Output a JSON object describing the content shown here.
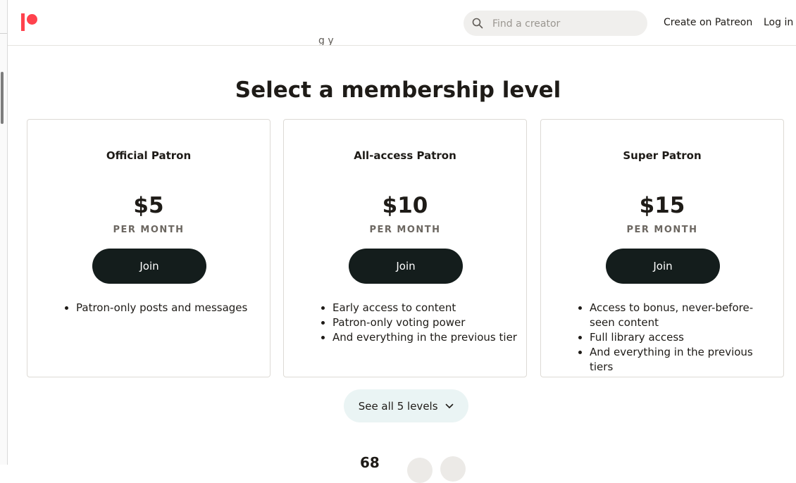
{
  "header": {
    "search_placeholder": "Find a creator",
    "create_label": "Create on Patreon",
    "login_label": "Log in"
  },
  "main": {
    "clipped_text": "g   y",
    "title": "Select a membership level",
    "tiers": [
      {
        "name": "Official Patron",
        "price": "$5",
        "period": "PER MONTH",
        "join_label": "Join",
        "benefits": [
          "Patron-only posts and messages"
        ]
      },
      {
        "name": "All-access Patron",
        "price": "$10",
        "period": "PER MONTH",
        "join_label": "Join",
        "benefits": [
          "Early access to content",
          "Patron-only voting power",
          "And everything in the previous tier"
        ]
      },
      {
        "name": "Super Patron",
        "price": "$15",
        "period": "PER MONTH",
        "join_label": "Join",
        "benefits": [
          "Access to bonus, never-before-seen content",
          "Full library access",
          "And everything in the previous tiers"
        ]
      }
    ],
    "see_all_label": "See all 5 levels",
    "bottom_number": "68"
  },
  "colors": {
    "brand": "#ff424d",
    "join_button": "#141d1c",
    "see_all_bg": "#eaf4f4"
  },
  "icons": [
    "patreon-logo",
    "search-icon",
    "chevron-down-icon"
  ]
}
